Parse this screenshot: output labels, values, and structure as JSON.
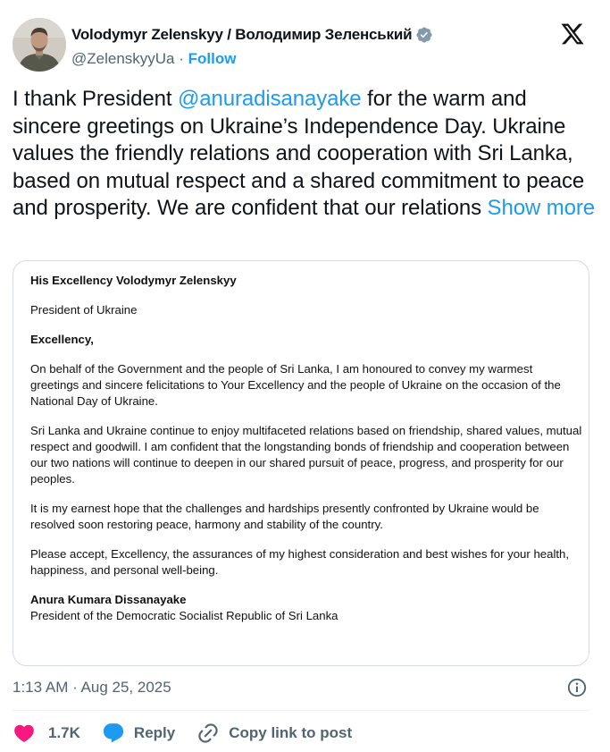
{
  "author": {
    "display_name": "Volodymyr Zelenskyy / Володимир Зеленський",
    "handle": "@ZelenskyyUa",
    "separator": "·",
    "follow_label": "Follow",
    "verified_color": "#829aab"
  },
  "tweet": {
    "text_before": "I thank President ",
    "mention": "@anuradisanayake",
    "text_after": " for the warm and sincere greetings on Ukraine’s Independence Day. Ukraine values the friendly relations and cooperation with Sri Lanka, based on mutual respect and a shared commitment to peace and prosperity. We are confident that our relations ",
    "show_more": "Show more"
  },
  "letter": {
    "salutation_name": "His Excellency Volodymyr Zelenskyy",
    "salutation_title": "President of Ukraine",
    "greeting": "Excellency,",
    "paragraphs": [
      "On behalf of the Government and the people of Sri Lanka, I am honoured to convey my warmest greetings and sincere felicitations to Your Excellency and the people of Ukraine on the occasion of the National Day of Ukraine.",
      "Sri Lanka and Ukraine continue to enjoy multifaceted relations based on friendship, shared values, mutual respect and goodwill. I am confident that the longstanding bonds of friendship and cooperation between our two nations will continue to deepen in our shared pursuit of peace, progress, and prosperity for our peoples.",
      "It is my earnest hope that the challenges and hardships presently confronted by Ukraine would be resolved soon restoring peace, harmony and stability of the country.",
      "Please accept, Excellency, the assurances of my highest consideration and best wishes for your health, happiness, and personal well-being."
    ],
    "signature_name": "Anura Kumara Dissanayake",
    "signature_title": "President of the Democratic Socialist Republic of Sri Lanka"
  },
  "meta": {
    "timestamp": "1:13 AM · Aug 25, 2025"
  },
  "actions": {
    "like_count": "1.7K",
    "reply_label": "Reply",
    "copy_link_label": "Copy link to post"
  },
  "colors": {
    "accent": "#1d9bf0",
    "like": "#f91880",
    "secondary_text": "#536471"
  },
  "icons": {
    "verified": "verified-badge-icon",
    "logo": "x-logo-icon",
    "info": "info-icon",
    "like": "heart-icon",
    "reply": "speech-bubble-icon",
    "copy_link": "link-icon"
  }
}
